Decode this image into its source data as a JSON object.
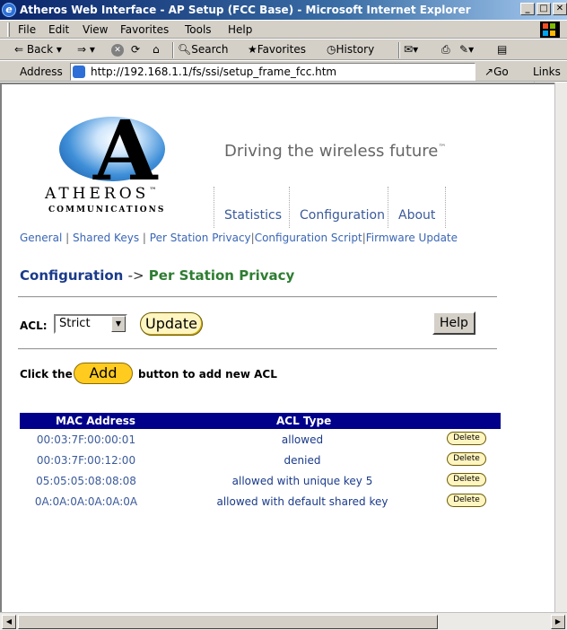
{
  "window": {
    "title": "Atheros Web Interface - AP Setup (FCC Base) - Microsoft Internet Explorer"
  },
  "menu": {
    "items": [
      "File",
      "Edit",
      "View",
      "Favorites",
      "Tools",
      "Help"
    ]
  },
  "toolbar": {
    "back": "Back",
    "search": "Search",
    "favorites": "Favorites",
    "history": "History"
  },
  "address": {
    "label": "Address",
    "url": "http://192.168.1.1/fs/ssi/setup_frame_fcc.htm",
    "go": "Go",
    "links": "Links"
  },
  "brand": {
    "name": "ATHEROS",
    "tm": "™",
    "sub": "COMMUNICATIONS",
    "tagline": "Driving the wireless future",
    "tagline_tm": "™"
  },
  "topnav": [
    "Statistics",
    "Configuration",
    "About"
  ],
  "subnav": [
    "General",
    "Shared Keys",
    "Per Station Privacy",
    "Configuration Script",
    "Firmware Update"
  ],
  "breadcrumb": {
    "section": "Configuration",
    "arrow": "->",
    "page": "Per Station Privacy"
  },
  "acl": {
    "label": "ACL:",
    "selected": "Strict",
    "update_label": "Update",
    "help_label": "Help"
  },
  "add": {
    "prefix": "Click the",
    "label": "Add",
    "suffix": "button to add new ACL"
  },
  "table": {
    "headers": [
      "MAC Address",
      "ACL Type"
    ],
    "delete_label": "Delete",
    "rows": [
      {
        "mac": "00:03:7F:00:00:01",
        "type": "allowed"
      },
      {
        "mac": "00:03:7F:00:12:00",
        "type": "denied"
      },
      {
        "mac": "05:05:05:08:08:08",
        "type": "allowed with unique key 5"
      },
      {
        "mac": "0A:0A:0A:0A:0A:0A",
        "type": "allowed with default shared key"
      }
    ]
  }
}
